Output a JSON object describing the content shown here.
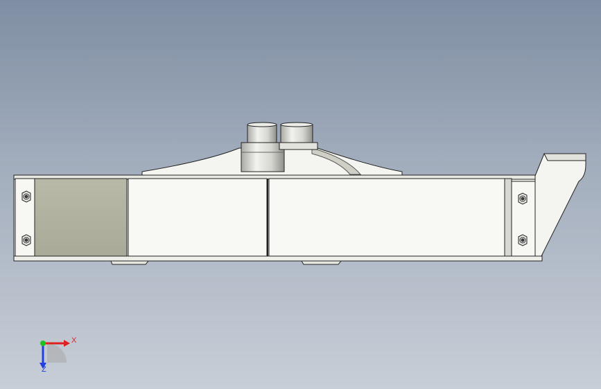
{
  "triad": {
    "x_label": "X",
    "z_label": "Z",
    "x_color": "#e02020",
    "y_color": "#20c020",
    "z_color": "#2040e0"
  },
  "colors": {
    "background_top": "#7f8ea3",
    "background_bottom": "#c8ced7",
    "part_fill": "#f4f4f0",
    "part_edge": "#222222",
    "gray_panel": "#b1b1a0",
    "cylinder": "#d8d8d4"
  }
}
